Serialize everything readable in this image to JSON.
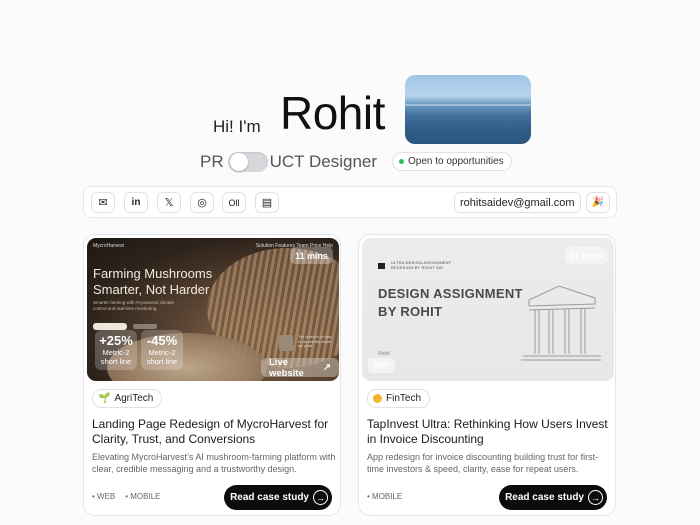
{
  "hero": {
    "greeting": "Hi! I'm",
    "name": "Rohit",
    "role_prefix": "PR",
    "role_suffix": "UCT Designer",
    "availability": "Open to opportunities",
    "accent_green": "#2fbf55"
  },
  "contact": {
    "icons": [
      "mail-icon",
      "linkedin-icon",
      "x-icon",
      "instagram-icon",
      "read-cv-icon",
      "resume-icon"
    ],
    "icon_glyphs": [
      "✉",
      "in",
      "𝕏",
      "◎",
      "Oll",
      "▤"
    ],
    "email": "rohitsaidev@gmail.com",
    "confetti_glyph": "🎉"
  },
  "cards": [
    {
      "thumb": {
        "nav_brand": "MycroHarvest",
        "nav_links": "Solution   Features   Team   Price   Help",
        "headline_1": "Farming Mushrooms",
        "headline_2": "Smarter, Not Harder",
        "sub": "Smarter farming with AI-powered climate control and real-time monitoring.",
        "stat1_value": "+25%",
        "stat1_label_1": "Metric-2",
        "stat1_label_2": "short line",
        "stat2_value": "-45%",
        "stat2_label_1": "Metric-2",
        "stat2_label_2": "short line",
        "testimonial": "The control is so easy to use and the results are great.",
        "live_label": "Live website",
        "live_glyph": "↗",
        "duration": "11 mins"
      },
      "tag": "AgriTech",
      "tag_glyph": "🌱",
      "title": "Landing Page Redesign of MycroHarvest for Clarity, Trust, and Conversions",
      "description": "Elevating MycroHarvest’s AI mushroom-farming platform with clear, credible messaging and a trustworthy design.",
      "platforms": [
        "• WEB",
        "• MOBILE"
      ],
      "cta": "Read case study",
      "cta_glyph": "→"
    },
    {
      "thumb": {
        "logo_text_1": "ULTRA DESIGN ASSIGNMENT",
        "logo_text_2": "REDESIGN BY ROHIT SAI",
        "title_1": "DESIGN ASSIGNMENT",
        "title_2": "BY ROHIT",
        "signature": "Rohit",
        "wip": "WIP",
        "duration": "11 mins"
      },
      "tag": "FinTech",
      "title": "TapInvest Ultra: Rethinking How Users Invest in Invoice Discounting",
      "description": "App redesign for invoice discounting building trust for first-time investors & speed, clarity, ease for repeat users.",
      "platforms": [
        "• MOBILE"
      ],
      "cta": "Read case study",
      "cta_glyph": "→"
    }
  ]
}
